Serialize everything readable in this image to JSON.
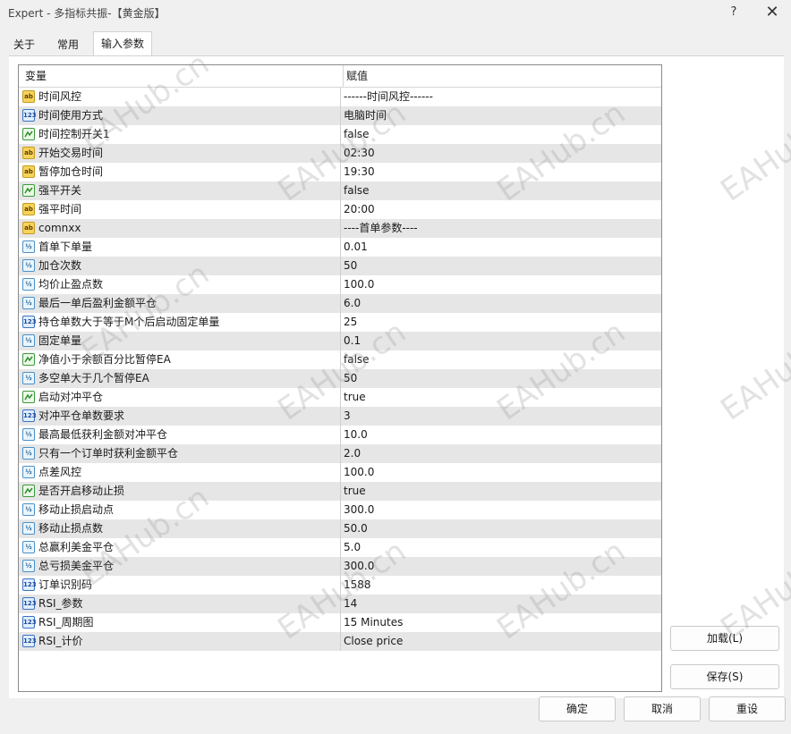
{
  "window": {
    "title": "Expert - 多指标共振-【黄金版】",
    "help_label": "?",
    "close_label": "✕"
  },
  "tabs": [
    "关于",
    "常用",
    "输入参数"
  ],
  "grid": {
    "col_variable": "变量",
    "col_value": "赋值",
    "rows": [
      {
        "type": "str",
        "name": "时间风控",
        "value": "------时间风控------"
      },
      {
        "type": "int",
        "name": "时间使用方式",
        "value": "电脑时间"
      },
      {
        "type": "bool",
        "name": "时间控制开关1",
        "value": "false"
      },
      {
        "type": "str",
        "name": "开始交易时间",
        "value": "02:30"
      },
      {
        "type": "str",
        "name": "暂停加仓时间",
        "value": "19:30"
      },
      {
        "type": "bool",
        "name": "强平开关",
        "value": "false"
      },
      {
        "type": "str",
        "name": "强平时间",
        "value": "20:00"
      },
      {
        "type": "str",
        "name": "comnxx",
        "value": "----首单参数----"
      },
      {
        "type": "dbl",
        "name": "首单下单量",
        "value": "0.01"
      },
      {
        "type": "dbl",
        "name": "加仓次数",
        "value": "50"
      },
      {
        "type": "dbl",
        "name": "均价止盈点数",
        "value": "100.0"
      },
      {
        "type": "dbl",
        "name": "最后一单后盈利金额平仓",
        "value": "6.0"
      },
      {
        "type": "int",
        "name": "持仓单数大于等于M个后启动固定单量",
        "value": "25"
      },
      {
        "type": "dbl",
        "name": "固定单量",
        "value": "0.1"
      },
      {
        "type": "bool",
        "name": "净值小于余额百分比暂停EA",
        "value": "false"
      },
      {
        "type": "dbl",
        "name": "多空单大于几个暂停EA",
        "value": "50"
      },
      {
        "type": "bool",
        "name": "启动对冲平仓",
        "value": "true"
      },
      {
        "type": "int",
        "name": "对冲平仓单数要求",
        "value": "3"
      },
      {
        "type": "dbl",
        "name": "最高最低获利金额对冲平仓",
        "value": "10.0"
      },
      {
        "type": "dbl",
        "name": "只有一个订单时获利金额平仓",
        "value": "2.0"
      },
      {
        "type": "dbl",
        "name": "点差风控",
        "value": "100.0"
      },
      {
        "type": "bool",
        "name": "是否开启移动止损",
        "value": "true"
      },
      {
        "type": "dbl",
        "name": "移动止损启动点",
        "value": "300.0"
      },
      {
        "type": "dbl",
        "name": "移动止损点数",
        "value": "50.0"
      },
      {
        "type": "dbl",
        "name": "总赢利美金平仓",
        "value": "5.0"
      },
      {
        "type": "dbl",
        "name": "总亏损美金平仓",
        "value": "300.0"
      },
      {
        "type": "int",
        "name": "订单识别码",
        "value": "1588"
      },
      {
        "type": "int",
        "name": "RSI_参数",
        "value": "14"
      },
      {
        "type": "int",
        "name": "RSI_周期图",
        "value": "15 Minutes"
      },
      {
        "type": "int",
        "name": "RSI_计价",
        "value": "Close price"
      }
    ]
  },
  "icons": {
    "str": "ab",
    "int": "123",
    "dbl": "½"
  },
  "buttons": {
    "load": "加载(L)",
    "save": "保存(S)",
    "ok": "确定",
    "cancel": "取消",
    "reset": "重设"
  },
  "watermark_text": "EAHub.cn"
}
